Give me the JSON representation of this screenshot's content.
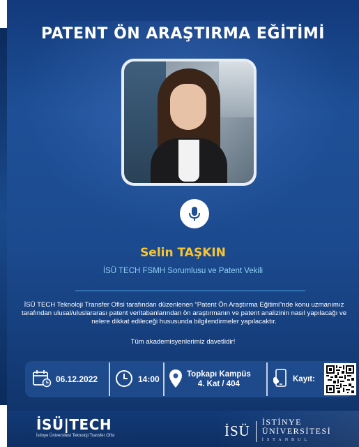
{
  "poster": {
    "title": "PATENT ÖN ARAŞTIRMA EĞİTİMİ",
    "speaker": {
      "name": "Selin TAŞKIN",
      "role": "İSÜ TECH FSMH Sorumlusu ve Patent Vekili"
    },
    "description": "İSÜ TECH Teknoloji Transfer Ofisi tarafından düzenlenen “Patent Ön Araştırma Eğitimi”nde konu uzmanımız tarafından ulusal/uluslararası patent veritabanlarından ön araştırmanın ve patent analizinin nasıl yapılacağı ve nelere dikkat edileceği hususunda bilgilendirmeler yapılacaktır.",
    "invitation": "Tüm akademisyenlerimiz davetlidir!",
    "info": {
      "date": "06.12.2022",
      "time": "14:00",
      "place_line1": "Topkapı Kampüs",
      "place_line2": "4. Kat / 404",
      "register_label": "Kayıt:"
    },
    "footer": {
      "left_logo_main": "İSÜ|TECH",
      "left_logo_sub": "İstinye Üniversitesi Teknoloji Transfer Ofisi",
      "right_logo_isu": "İSÜ",
      "right_logo_line1": "İSTİNYE",
      "right_logo_line2": "ÜNİVERSİTESİ",
      "right_logo_line3": "İSTANBUL"
    }
  },
  "colors": {
    "background": "#1e4f96",
    "speaker_name": "#f7c531",
    "speaker_role": "#8fd0f5",
    "divider": "#4fa8e8"
  },
  "icons": [
    "microphone-icon",
    "calendar-icon",
    "clock-icon",
    "location-pin-icon",
    "phone-register-icon",
    "qr-code"
  ]
}
